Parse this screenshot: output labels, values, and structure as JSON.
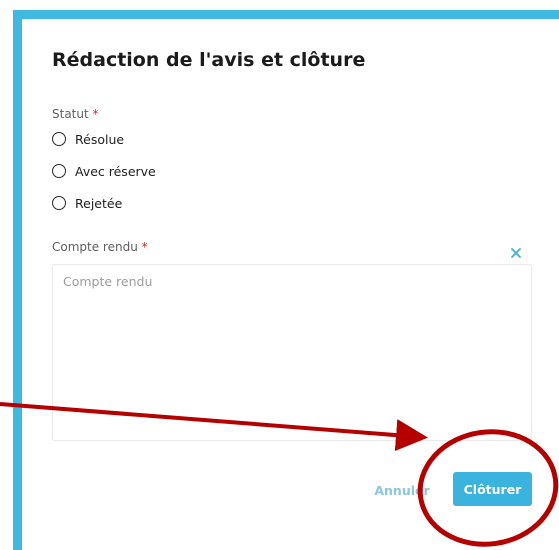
{
  "dialog": {
    "title": "Rédaction de l'avis et clôture",
    "statut_label": "Statut",
    "required_marker": "*",
    "status_options": [
      "Résolue",
      "Avec réserve",
      "Rejetée"
    ],
    "compte_rendu_label": "Compte rendu",
    "compte_rendu_value": "",
    "compte_rendu_placeholder": "Compte rendu",
    "cancel_label": "Annuler",
    "submit_label": "Clôturer"
  },
  "colors": {
    "accent": "#3ab4df",
    "frame": "#3fb9df",
    "required": "#e02020",
    "annotation": "#b50000"
  },
  "icons": {
    "clear_field": "close-icon"
  }
}
